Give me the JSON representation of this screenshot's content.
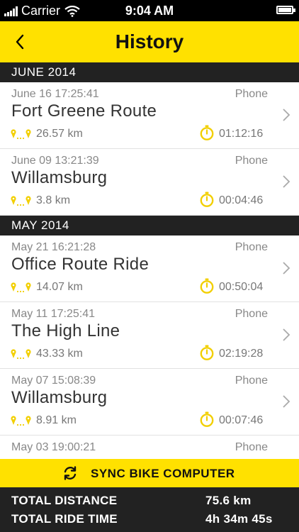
{
  "status_bar": {
    "carrier": "Carrier",
    "time": "9:04 AM"
  },
  "nav": {
    "title": "History",
    "back_icon": "chevron-left-icon"
  },
  "colors": {
    "accent": "#ffe100",
    "section_bg": "#222222"
  },
  "sections": [
    {
      "header": "JUNE 2014",
      "rides": [
        {
          "date": "June 16  17:25:41",
          "source": "Phone",
          "name": "Fort Greene Route",
          "distance": "26.57 km",
          "duration": "01:12:16"
        },
        {
          "date": "June 09  13:21:39",
          "source": "Phone",
          "name": "Willamsburg",
          "distance": "3.8 km",
          "duration": "00:04:46"
        }
      ]
    },
    {
      "header": "MAY 2014",
      "rides": [
        {
          "date": "May 21  16:21:28",
          "source": "Phone",
          "name": "Office Route Ride",
          "distance": "14.07 km",
          "duration": "00:50:04"
        },
        {
          "date": "May 11  17:25:41",
          "source": "Phone",
          "name": "The High Line",
          "distance": "43.33 km",
          "duration": "02:19:28"
        },
        {
          "date": "May 07  15:08:39",
          "source": "Phone",
          "name": "Willamsburg",
          "distance": "8.91 km",
          "duration": "00:07:46"
        },
        {
          "date": "May 03  19:00:21",
          "source": "Phone",
          "name": "",
          "distance": "",
          "duration": ""
        }
      ]
    }
  ],
  "sync": {
    "label": "SYNC BIKE COMPUTER",
    "icon": "sync-icon"
  },
  "totals": {
    "distance_label": "TOTAL DISTANCE",
    "distance_value": "75.6 km",
    "time_label": "TOTAL RIDE TIME",
    "time_value": "4h  34m  45s"
  }
}
